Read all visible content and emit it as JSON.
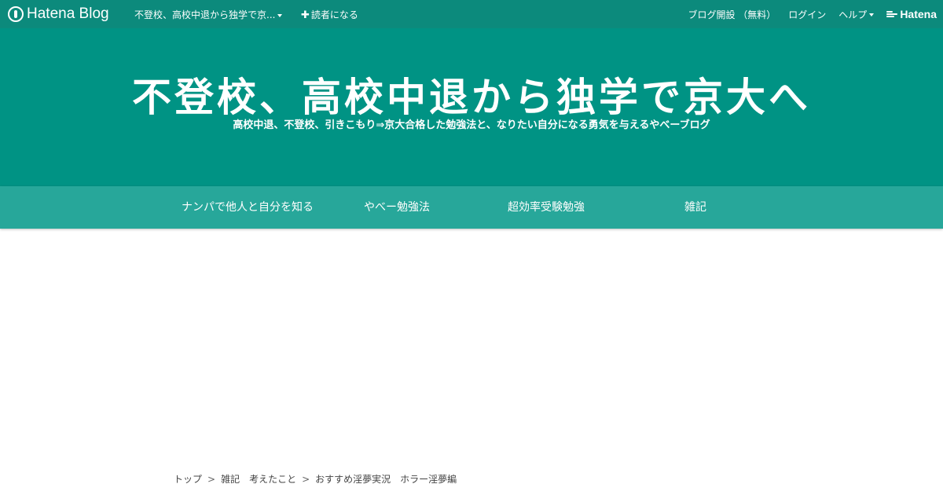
{
  "topbar": {
    "logo_text": "Hatena Blog",
    "blog_menu_label": "不登校、高校中退から独学で京...",
    "subscribe_label": "読者になる",
    "open_blog_label": "ブログ開設 （無料）",
    "login_label": "ログイン",
    "help_label": "ヘルプ",
    "hatena_label": "Hatena"
  },
  "header": {
    "title": "不登校、高校中退から独学で京大へ",
    "description": "高校中退、不登校、引きこもり⇒京大合格した勉強法と、なりたい自分になる勇気を与えるやべーブログ"
  },
  "nav": {
    "items": [
      {
        "label": "ナンパで他人と自分を知る"
      },
      {
        "label": "やべー勉強法"
      },
      {
        "label": "超効率受験勉強"
      },
      {
        "label": "雑記"
      }
    ]
  },
  "breadcrumb": {
    "items": [
      "トップ",
      "雑記　考えたこと",
      "おすすめ淫夢実況　ホラー淫夢編"
    ],
    "separator": ">"
  },
  "colors": {
    "topbar_bg": "#0c8a7c",
    "header_bg": "#009384",
    "nav_bg": "#27a79a",
    "page_bg": "#ffffff"
  }
}
